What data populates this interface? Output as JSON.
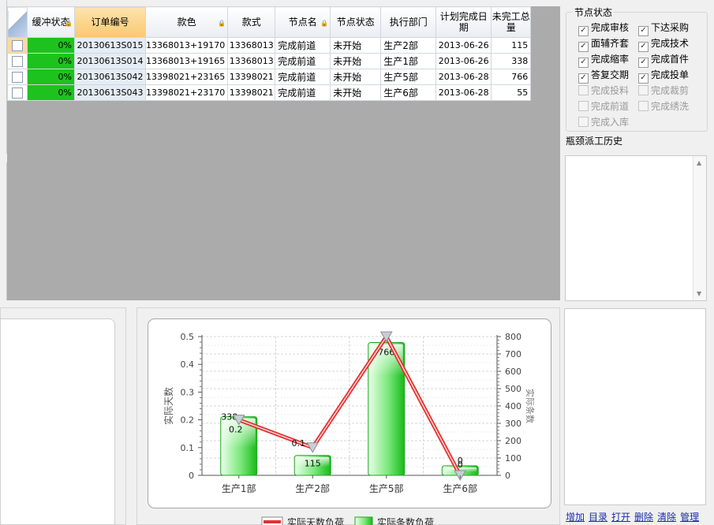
{
  "grid": {
    "columns": [
      {
        "key": "buffer",
        "label": "缓冲状态",
        "lock": true
      },
      {
        "key": "order",
        "label": "订单编号",
        "lock": false,
        "sorted": true
      },
      {
        "key": "color",
        "label": "款色",
        "lock": true
      },
      {
        "key": "style",
        "label": "款式",
        "lock": false
      },
      {
        "key": "node",
        "label": "节点名",
        "lock": true
      },
      {
        "key": "nodestatus",
        "label": "节点状态",
        "lock": false
      },
      {
        "key": "dept",
        "label": "执行部门",
        "lock": false
      },
      {
        "key": "plandate",
        "label": "计划完成日期",
        "lock": false
      },
      {
        "key": "remain",
        "label": "未完工总量",
        "lock": false
      }
    ],
    "rows": [
      {
        "buffer": "0%",
        "order": "20130613S015",
        "color": "13368013+19170",
        "style": "13368013",
        "node": "完成前道",
        "nodestatus": "未开始",
        "dept": "生产2部",
        "plandate": "2013-06-26",
        "remain": "115"
      },
      {
        "buffer": "0%",
        "order": "20130613S014",
        "color": "13368013+19165",
        "style": "13368013",
        "node": "完成前道",
        "nodestatus": "未开始",
        "dept": "生产1部",
        "plandate": "2013-06-26",
        "remain": "338"
      },
      {
        "buffer": "0%",
        "order": "20130613S042",
        "color": "13398021+23165",
        "style": "13398021",
        "node": "完成前道",
        "nodestatus": "未开始",
        "dept": "生产5部",
        "plandate": "2013-06-28",
        "remain": "766"
      },
      {
        "buffer": "0%",
        "order": "20130613S043",
        "color": "13398021+23170",
        "style": "13398021",
        "node": "完成前道",
        "nodestatus": "未开始",
        "dept": "生产6部",
        "plandate": "2013-06-28",
        "remain": "55"
      }
    ],
    "buffer_color": "#1ec21e"
  },
  "node_status": {
    "title": "节点状态",
    "options": [
      {
        "label": "完成审核",
        "checked": true,
        "enabled": true
      },
      {
        "label": "下达采购",
        "checked": true,
        "enabled": true
      },
      {
        "label": "面辅齐套",
        "checked": true,
        "enabled": true
      },
      {
        "label": "完成技术",
        "checked": true,
        "enabled": true
      },
      {
        "label": "完成缩率",
        "checked": true,
        "enabled": true
      },
      {
        "label": "完成首件",
        "checked": true,
        "enabled": true
      },
      {
        "label": "答复交期",
        "checked": true,
        "enabled": true
      },
      {
        "label": "完成投单",
        "checked": true,
        "enabled": true
      },
      {
        "label": "完成投料",
        "checked": false,
        "enabled": false
      },
      {
        "label": "完成裁剪",
        "checked": false,
        "enabled": false
      },
      {
        "label": "完成前道",
        "checked": false,
        "enabled": false
      },
      {
        "label": "完成绣洗",
        "checked": false,
        "enabled": false
      },
      {
        "label": "完成入库",
        "checked": false,
        "enabled": false
      }
    ]
  },
  "history": {
    "title": "瓶颈派工历史"
  },
  "links": [
    "增加",
    "目录",
    "打开",
    "删除",
    "清除",
    "管理"
  ],
  "chart_data": {
    "type": "bar",
    "categories": [
      "生产1部",
      "生产2部",
      "生产5部",
      "生产6部"
    ],
    "series": [
      {
        "name": "实际条数负荷",
        "type": "bar",
        "axis": "right",
        "values": [
          338,
          115,
          766,
          55
        ],
        "labels": [
          "338",
          "115",
          "766",
          "0"
        ],
        "color": "#2fd62f"
      },
      {
        "name": "实际天数负荷",
        "type": "line",
        "axis": "left",
        "values": [
          0.2,
          0.1,
          0.5,
          0
        ],
        "labels": [
          "0.2",
          "0.1",
          "",
          "0"
        ],
        "color": "#e23232"
      }
    ],
    "ylabel": "实际天数",
    "y2label": "实际条数",
    "ylim": [
      0,
      0.5
    ],
    "yticks": [
      "0",
      "0.1",
      "0.2",
      "0.3",
      "0.4",
      "0.5"
    ],
    "y2lim": [
      0,
      800
    ],
    "y2ticks": [
      "0",
      "100",
      "200",
      "300",
      "400",
      "500",
      "600",
      "700",
      "800"
    ],
    "grid": true,
    "legend": "bottom"
  }
}
